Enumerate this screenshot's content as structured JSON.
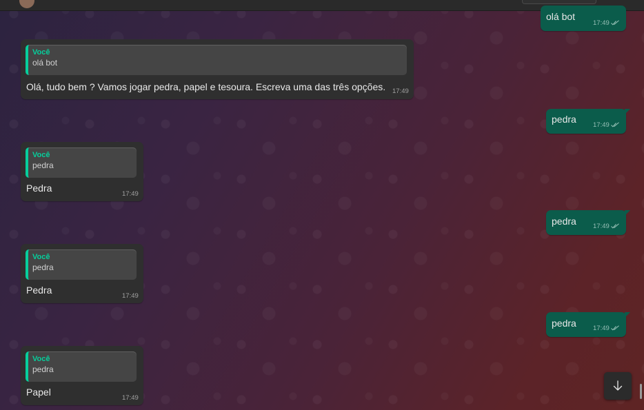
{
  "colors": {
    "incoming_bubble": "#2f2f2f",
    "outgoing_bubble": "#0b5c4b",
    "quote_accent": "#06cf9c"
  },
  "messages": [
    {
      "direction": "outgoing",
      "text": "olá bot",
      "time": "17:49",
      "status": "read-double-check-icon"
    },
    {
      "direction": "incoming",
      "quote": {
        "author": "Você",
        "text": "olá bot"
      },
      "text": "Olá, tudo bem ? Vamos jogar pedra, papel e tesoura. Escreva uma das três opções.",
      "time": "17:49"
    },
    {
      "direction": "outgoing",
      "text": "pedra",
      "time": "17:49",
      "status": "read-double-check-icon"
    },
    {
      "direction": "incoming",
      "quote": {
        "author": "Você",
        "text": "pedra"
      },
      "text": "Pedra",
      "time": "17:49"
    },
    {
      "direction": "outgoing",
      "text": "pedra",
      "time": "17:49",
      "status": "read-double-check-icon"
    },
    {
      "direction": "incoming",
      "quote": {
        "author": "Você",
        "text": "pedra"
      },
      "text": "Pedra",
      "time": "17:49"
    },
    {
      "direction": "outgoing",
      "text": "pedra",
      "time": "17:49",
      "status": "read-double-check-icon"
    },
    {
      "direction": "incoming",
      "quote": {
        "author": "Você",
        "text": "pedra"
      },
      "text": "Papel",
      "time": "17:49"
    }
  ],
  "scroll_down_button": {
    "icon": "arrow-down-icon"
  }
}
